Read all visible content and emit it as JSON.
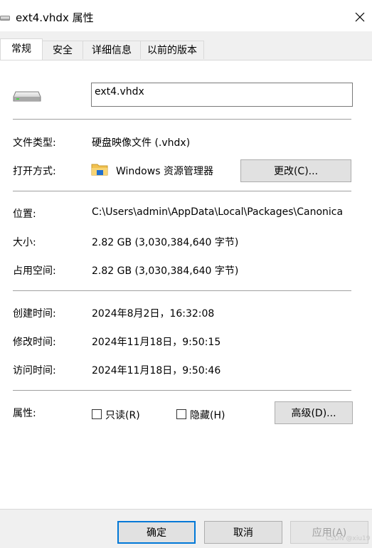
{
  "window": {
    "title": "ext4.vhdx 属性",
    "icon": "drive-icon"
  },
  "tabs": [
    {
      "label": "常规",
      "active": true
    },
    {
      "label": "安全",
      "active": false
    },
    {
      "label": "详细信息",
      "active": false
    },
    {
      "label": "以前的版本",
      "active": false
    }
  ],
  "general": {
    "file_name": "ext4.vhdx",
    "file_type_label": "文件类型:",
    "file_type_value": "硬盘映像文件 (.vhdx)",
    "opens_with_label": "打开方式:",
    "opens_with_value": "Windows 资源管理器",
    "change_button": "更改(C)...",
    "location_label": "位置:",
    "location_value": "C:\\Users\\admin\\AppData\\Local\\Packages\\Canonica",
    "size_label": "大小:",
    "size_value": "2.82 GB (3,030,384,640 字节)",
    "size_on_disk_label": "占用空间:",
    "size_on_disk_value": "2.82 GB (3,030,384,640 字节)",
    "created_label": "创建时间:",
    "created_value": "2024年8月2日，16:32:08",
    "modified_label": "修改时间:",
    "modified_value": "2024年11月18日，9:50:15",
    "accessed_label": "访问时间:",
    "accessed_value": "2024年11月18日，9:50:46",
    "attributes_label": "属性:",
    "readonly_label": "只读(R)",
    "readonly_checked": false,
    "hidden_label": "隐藏(H)",
    "hidden_checked": false,
    "advanced_button": "高级(D)..."
  },
  "footer": {
    "ok_button": "确定",
    "cancel_button": "取消",
    "apply_button": "应用(A)",
    "apply_enabled": false
  },
  "watermark": "CSDN @xiu19",
  "colors": {
    "accent": "#0078d7",
    "folder": "#f2c14e",
    "disabled_text": "#a0a0a0"
  }
}
